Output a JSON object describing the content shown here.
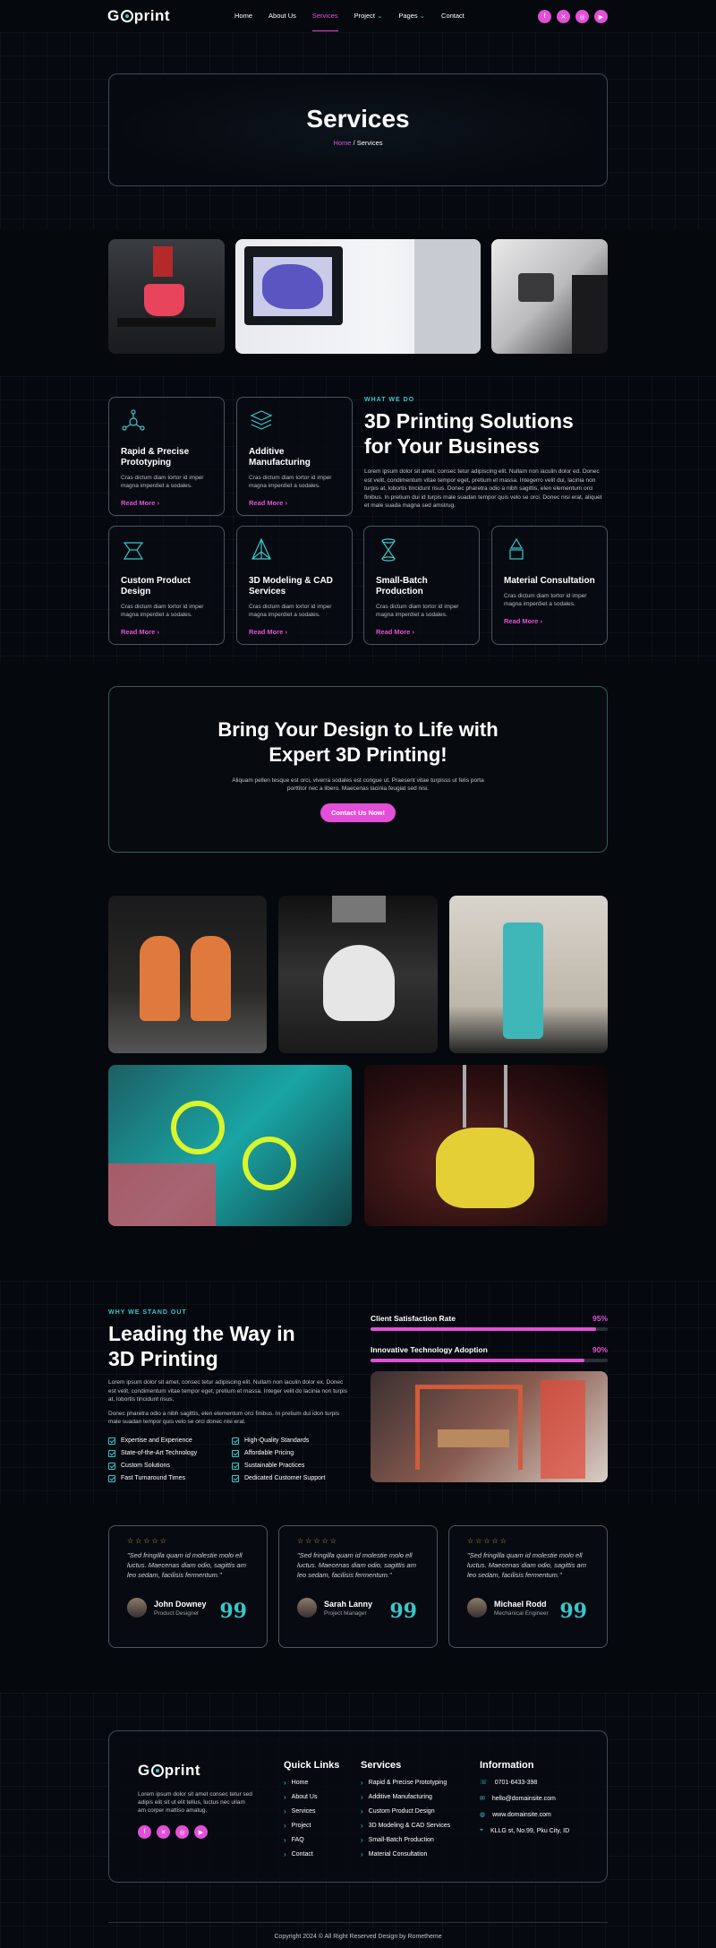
{
  "header": {
    "logo": "G print",
    "logo_left": "G",
    "logo_right": "print",
    "nav": [
      "Home",
      "About Us",
      "Services",
      "Project",
      "Pages",
      "Contact"
    ],
    "active": "Services"
  },
  "hero": {
    "title": "Services",
    "breadcrumb_home": "Home",
    "breadcrumb_sep": " / ",
    "breadcrumb_current": "Services"
  },
  "what_we_do": {
    "eyebrow": "WHAT WE DO",
    "title_line1": "3D Printing Solutions",
    "title_line2": "for Your Business",
    "body": "Lorem ipsum dolor sit amet, consec tetur adipiscing elit. Nullam non iaculin dolor ed. Donec est velit, condimentum vitae tempor eget, pretium et massa. Integerro velit dui, lacinia non turpis at, lobortis tincidunt risus. Donec pharetra odio a nibh sagittis, elen elementum orci finibus. In pretium dui id turpis male suadan tempor quis velo se orci. Donec nisi erat, aliquet et male suada magna sed amstrug."
  },
  "services": [
    {
      "title": "Rapid & Precise Prototyping",
      "desc": "Cras dictum diam tortor id imper magna imperdiet a sodales.",
      "link": "Read More",
      "icon": "molecule-icon"
    },
    {
      "title": "Additive Manufacturing",
      "desc": "Cras dictum diam tortor id imper magna imperdiet a sodales.",
      "link": "Read More",
      "icon": "layers-icon"
    },
    {
      "title": "Custom Product Design",
      "desc": "Cras dictum diam tortor id imper magna imperdiet a sodales.",
      "link": "Read More",
      "icon": "cube-outline-icon"
    },
    {
      "title": "3D Modeling & CAD Services",
      "desc": "Cras dictum diam tortor id imper magna imperdiet a sodales.",
      "link": "Read More",
      "icon": "pyramid-icon"
    },
    {
      "title": "Small-Batch Production",
      "desc": "Cras dictum diam tortor id imper magna imperdiet a sodales.",
      "link": "Read More",
      "icon": "hourglass-icon"
    },
    {
      "title": "Material Consultation",
      "desc": "Cras dictum diam tortor id imper magna imperdiet a sodales.",
      "link": "Read More",
      "icon": "shapes-icon"
    }
  ],
  "cta": {
    "title_line1": "Bring Your Design to Life with",
    "title_line2": "Expert 3D Printing!",
    "body_line1": "Aliquam pellen tesque est orci, viverra sodales est congue ut. Praesent vitae turpisss ut felis porta",
    "body_line2": "porttitor nec a libero. Maecenas lacinia feugiat sed nisi.",
    "button": "Contact Us Now!"
  },
  "stand_out": {
    "eyebrow": "WHY WE STAND OUT",
    "title_line1": "Leading the Way in",
    "title_line2": "3D Printing",
    "body1": "Lorem ipsum dolor sit amet, consec tetur adipiscing elit. Nullam non iaculin dolor ex. Donec est velit, condimentum vitae tempor eget, pretium et massa. Integer velit do lacinia non turpis at, lobortis tincidunt risus.",
    "body2": "Donec pharetra odio a nibh sagittis, elen elementum orci finibus. In pretium dui idon turpis male suadan tempor quis velo se orci donec nisi erat.",
    "features_left": [
      "Expertise and Experience",
      "State-of-the-Art Technology",
      "Custom Solutions",
      "Fast Turnaround Times"
    ],
    "features_right": [
      "High-Quality Standards",
      "Affordable Pricing",
      "Sustainable Practices",
      "Dedicated Customer Support"
    ],
    "bars": [
      {
        "label": "Client Satisfaction Rate",
        "value": "95%",
        "fraction": 0.95
      },
      {
        "label": "Innovative Technology Adoption",
        "value": "90%",
        "fraction": 0.9
      }
    ]
  },
  "testimonials": [
    {
      "quote": "\"Sed fringilla quam id molestie molo ell luctus. Maecenas diam odio, sagittis am leo sedam, facilisis fermentum.\"",
      "name": "John Downey",
      "role": "Product Designer"
    },
    {
      "quote": "\"Sed fringilla quam id molestie molo ell luctus. Maecenas diam odio, sagittis am leo sedam, facilisis fermentum.\"",
      "name": "Sarah Lanny",
      "role": "Project Manager"
    },
    {
      "quote": "\"Sed fringilla quam id molestie molo ell luctus. Maecenas diam odio, sagittis am leo sedam, facilisis fermentum.\"",
      "name": "Michael Rodd",
      "role": "Mechanical Engineer"
    }
  ],
  "stars": "☆☆☆☆☆",
  "quote_mark": "99",
  "footer": {
    "logo_left": "G",
    "logo_right": "print",
    "about": "Lorem ipsum dolor sit amet consec tetur sed adipis elit sit ut elit tellus, luctus nec ullam am corper mattiso amatug.",
    "quick_title": "Quick Links",
    "quick_links": [
      "Home",
      "About Us",
      "Services",
      "Project",
      "FAQ",
      "Contact"
    ],
    "services_title": "Services",
    "service_links": [
      "Rapid & Precise Prototyping",
      "Additive Manufacturing",
      "Custom Product Design",
      "3D Modeling & CAD Services",
      "Small-Batch Production",
      "Material Consultation"
    ],
    "info_title": "Information",
    "phone": "0701-6433-398",
    "email": "hello@domainsite.com",
    "website": "www.domainsite.com",
    "address": "KLLG st, No.99, Pku City, ID",
    "copyright": "Copyright 2024 © All Right Reserved Design by Rometheme"
  },
  "colors": {
    "accent": "#e34fd8",
    "teal": "#3cc6c8",
    "bg": "#05080d"
  }
}
